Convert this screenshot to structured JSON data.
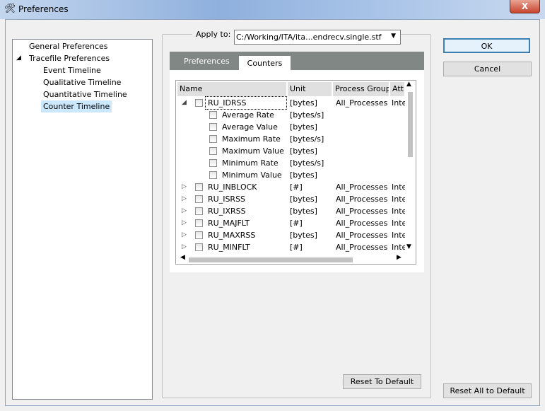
{
  "window": {
    "title": "Preferences",
    "close": "X"
  },
  "tree": [
    {
      "label": "General Preferences",
      "level": 0
    },
    {
      "label": "Tracefile Preferences",
      "level": 0,
      "expanded": true
    },
    {
      "label": "Event Timeline",
      "level": 1
    },
    {
      "label": "Qualitative Timeline",
      "level": 1
    },
    {
      "label": "Quantitative Timeline",
      "level": 1
    },
    {
      "label": "Counter Timeline",
      "level": 1,
      "selected": true
    }
  ],
  "apply": {
    "label": "Apply to:",
    "value": "C:/Working/ITA/ita...endrecv.single.stf"
  },
  "tabs": {
    "preferences": "Preferences",
    "counters": "Counters"
  },
  "table": {
    "headers": {
      "name": "Name",
      "unit": "Unit",
      "group": "Process Group",
      "attr": "Attri"
    },
    "rows": [
      {
        "name": "RU_IDRSS",
        "unit": "[bytes]",
        "group": "All_Processes",
        "attr": "Inte",
        "level": 0,
        "expanded": true
      },
      {
        "name": "Average Rate",
        "unit": "[bytes/s]",
        "group": "",
        "attr": "",
        "level": 1
      },
      {
        "name": "Average Value",
        "unit": "[bytes]",
        "group": "",
        "attr": "",
        "level": 1
      },
      {
        "name": "Maximum Rate",
        "unit": "[bytes/s]",
        "group": "",
        "attr": "",
        "level": 1
      },
      {
        "name": "Maximum Value",
        "unit": "[bytes]",
        "group": "",
        "attr": "",
        "level": 1
      },
      {
        "name": "Minimum Rate",
        "unit": "[bytes/s]",
        "group": "",
        "attr": "",
        "level": 1
      },
      {
        "name": "Minimum Value",
        "unit": "[bytes]",
        "group": "",
        "attr": "",
        "level": 1
      },
      {
        "name": "RU_INBLOCK",
        "unit": "[#]",
        "group": "All_Processes",
        "attr": "Inte",
        "level": 0
      },
      {
        "name": "RU_ISRSS",
        "unit": "[bytes]",
        "group": "All_Processes",
        "attr": "Inte",
        "level": 0
      },
      {
        "name": "RU_IXRSS",
        "unit": "[bytes]",
        "group": "All_Processes",
        "attr": "Inte",
        "level": 0
      },
      {
        "name": "RU_MAJFLT",
        "unit": "[#]",
        "group": "All_Processes",
        "attr": "Inte",
        "level": 0
      },
      {
        "name": "RU_MAXRSS",
        "unit": "[bytes]",
        "group": "All_Processes",
        "attr": "Inte",
        "level": 0
      },
      {
        "name": "RU_MINFLT",
        "unit": "[#]",
        "group": "All_Processes",
        "attr": "Inte",
        "level": 0
      }
    ]
  },
  "buttons": {
    "ok": "OK",
    "cancel": "Cancel",
    "reset_default": "Reset To Default",
    "reset_all": "Reset All to Default"
  }
}
